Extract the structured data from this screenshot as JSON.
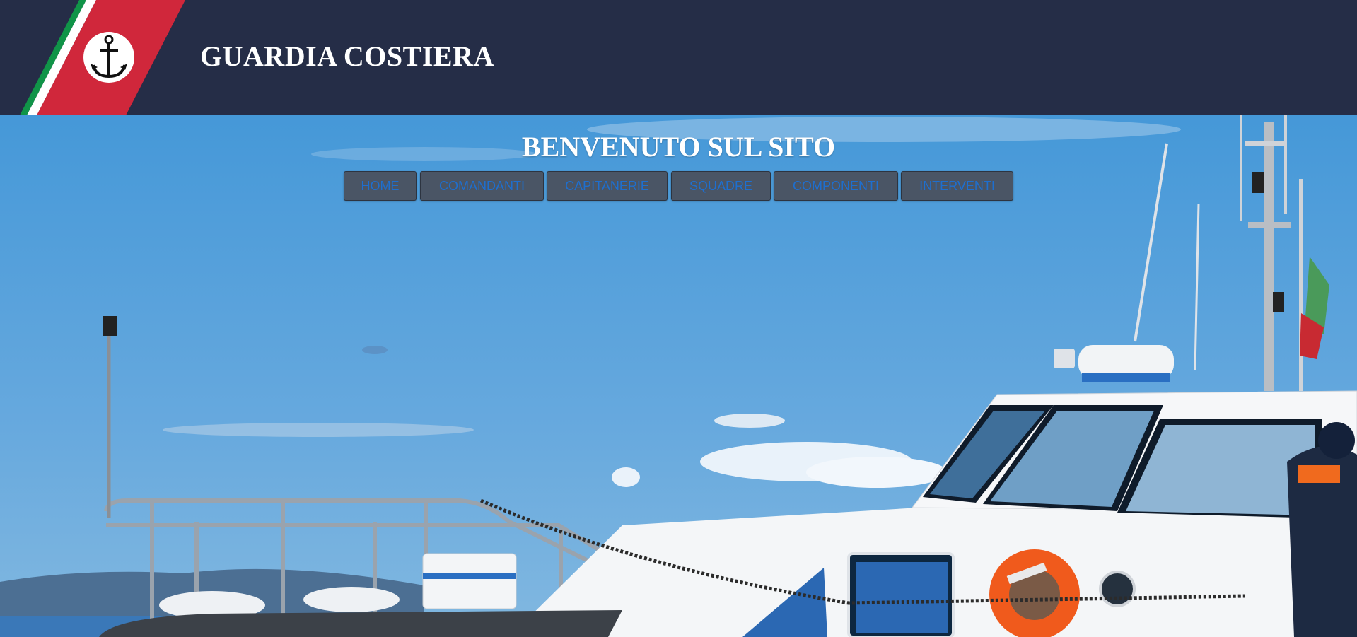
{
  "header": {
    "logo_icon": "anchor-icon",
    "title": "GUARDIA COSTIERA",
    "background": "#252d47",
    "stripe_colors": [
      "#ffffff",
      "#109448",
      "#d0273b"
    ]
  },
  "hero": {
    "title": "BENVENUTO SUL SITO",
    "image": "coast-guard-patrol-boat-photo"
  },
  "nav": {
    "items": [
      {
        "label": "HOME"
      },
      {
        "label": "COMANDANTI"
      },
      {
        "label": "CAPITANERIE"
      },
      {
        "label": "SQUADRE"
      },
      {
        "label": "COMPONENTI"
      },
      {
        "label": "INTERVENTI"
      }
    ]
  }
}
